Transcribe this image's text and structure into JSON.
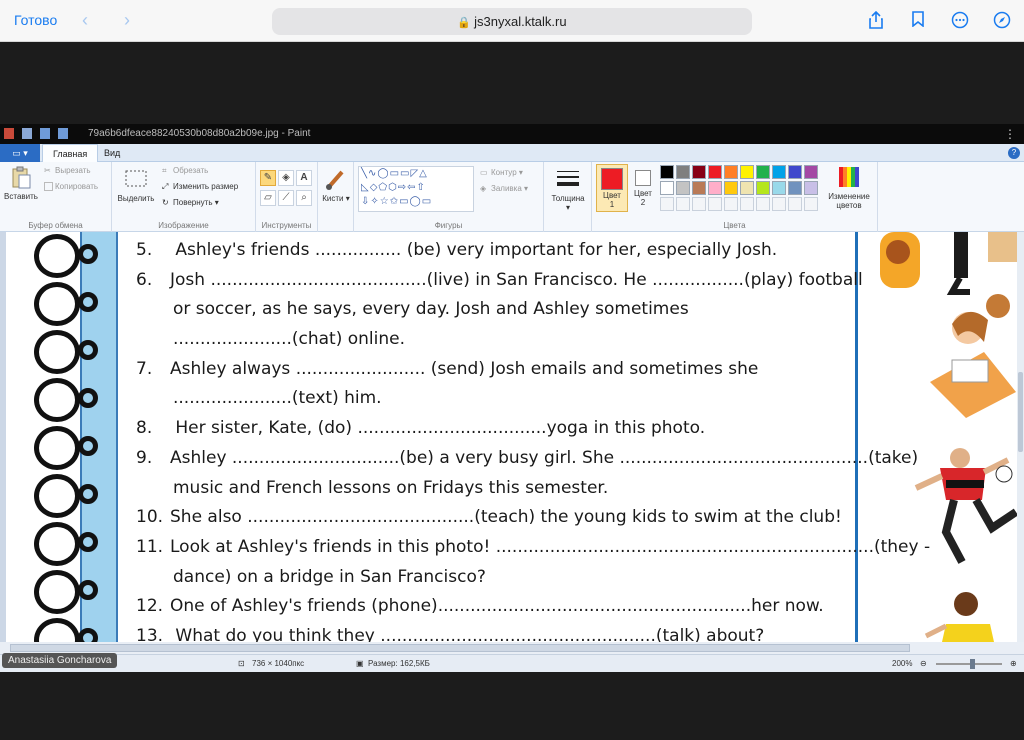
{
  "safari": {
    "done": "Готово",
    "url": "js3nyxal.ktalk.ru"
  },
  "paint": {
    "title": "79a6b6dfeace88240530b08d80a2b09e.jpg - Paint",
    "file_tab": "▭ ▾",
    "tabs": [
      "Главная",
      "Вид"
    ],
    "ribbon": {
      "clipboard": {
        "paste": "Вставить",
        "cut": "Вырезать",
        "copy": "Копировать",
        "label": "Буфер обмена"
      },
      "image": {
        "select": "Выделить",
        "crop": "Обрезать",
        "resize": "Изменить размер",
        "rotate": "Повернуть",
        "label": "Изображение"
      },
      "tools": {
        "label": "Инструменты",
        "text_tool": "A"
      },
      "brushes": {
        "label": "Кисти"
      },
      "shapes": {
        "outline": "Контур",
        "fill": "Заливка",
        "label": "Фигуры",
        "glyphs": "╲∿◯▭▭◸△\n◺◇⬠⬡⇨⇦⇧\n⇩✧☆✩▭◯▭"
      },
      "size": {
        "label": "Толщина"
      },
      "color1": {
        "label": "Цвет",
        "num": "1"
      },
      "color2": {
        "label": "Цвет",
        "num": "2"
      },
      "colors_label": "Цвета",
      "edit_colors": {
        "line1": "Изменение",
        "line2": "цветов"
      },
      "palette_row1": [
        "#000000",
        "#7f7f7f",
        "#880015",
        "#ed1c24",
        "#ff7f27",
        "#fff200",
        "#22b14c",
        "#00a2e8",
        "#3f48cc",
        "#a349a4"
      ],
      "palette_row2": [
        "#ffffff",
        "#c3c3c3",
        "#b97a57",
        "#ffaec9",
        "#ffc90e",
        "#efe4b0",
        "#b5e61d",
        "#99d9ea",
        "#7092be",
        "#c8bfe7"
      ],
      "color1_value": "#ed1c24",
      "color2_value": "#ffffff"
    },
    "worksheet": [
      {
        "num": "5.",
        "text": " Ashley's  friends ................ (be) very important for her, especially Josh."
      },
      {
        "num": "6.",
        "text": "Josh ........................................(live) in San Francisco. He .................(play) football"
      },
      {
        "num": "",
        "text": "or soccer, as he says, every day.  Josh and Ashley sometimes"
      },
      {
        "num": "",
        "text": "......................(chat) online."
      },
      {
        "num": "7.",
        "text": "Ashley  always  ........................ (send) Josh emails and sometimes she"
      },
      {
        "num": "",
        "text": "......................(text) him."
      },
      {
        "num": "8.",
        "text": " Her  sister, Kate,   (do) ...................................yoga in this photo."
      },
      {
        "num": "9.",
        "text": "Ashley  ...............................(be) a very busy girl. She ..............................................(take)"
      },
      {
        "num": "",
        "text": "music and French lessons on Fridays this semester."
      },
      {
        "num": "10.",
        "text": "She also  ..........................................(teach) the young kids to swim at the club!"
      },
      {
        "num": "11.",
        "text": "Look at Ashley's friends in this photo!  ......................................................................(they -"
      },
      {
        "num": "",
        "text": "dance) on a bridge in San Francisco?"
      },
      {
        "num": "12.",
        "text": "One  of Ashley's friends  (phone)..........................................................her  now."
      },
      {
        "num": "13.",
        "text": " What do you think they ...................................................(talk) about?"
      }
    ],
    "status": {
      "dimensions": "736 × 1040пкс",
      "size": "Размер: 162,5КБ",
      "zoom": "200%"
    }
  },
  "overlay_name": "Anastasiia Goncharova"
}
